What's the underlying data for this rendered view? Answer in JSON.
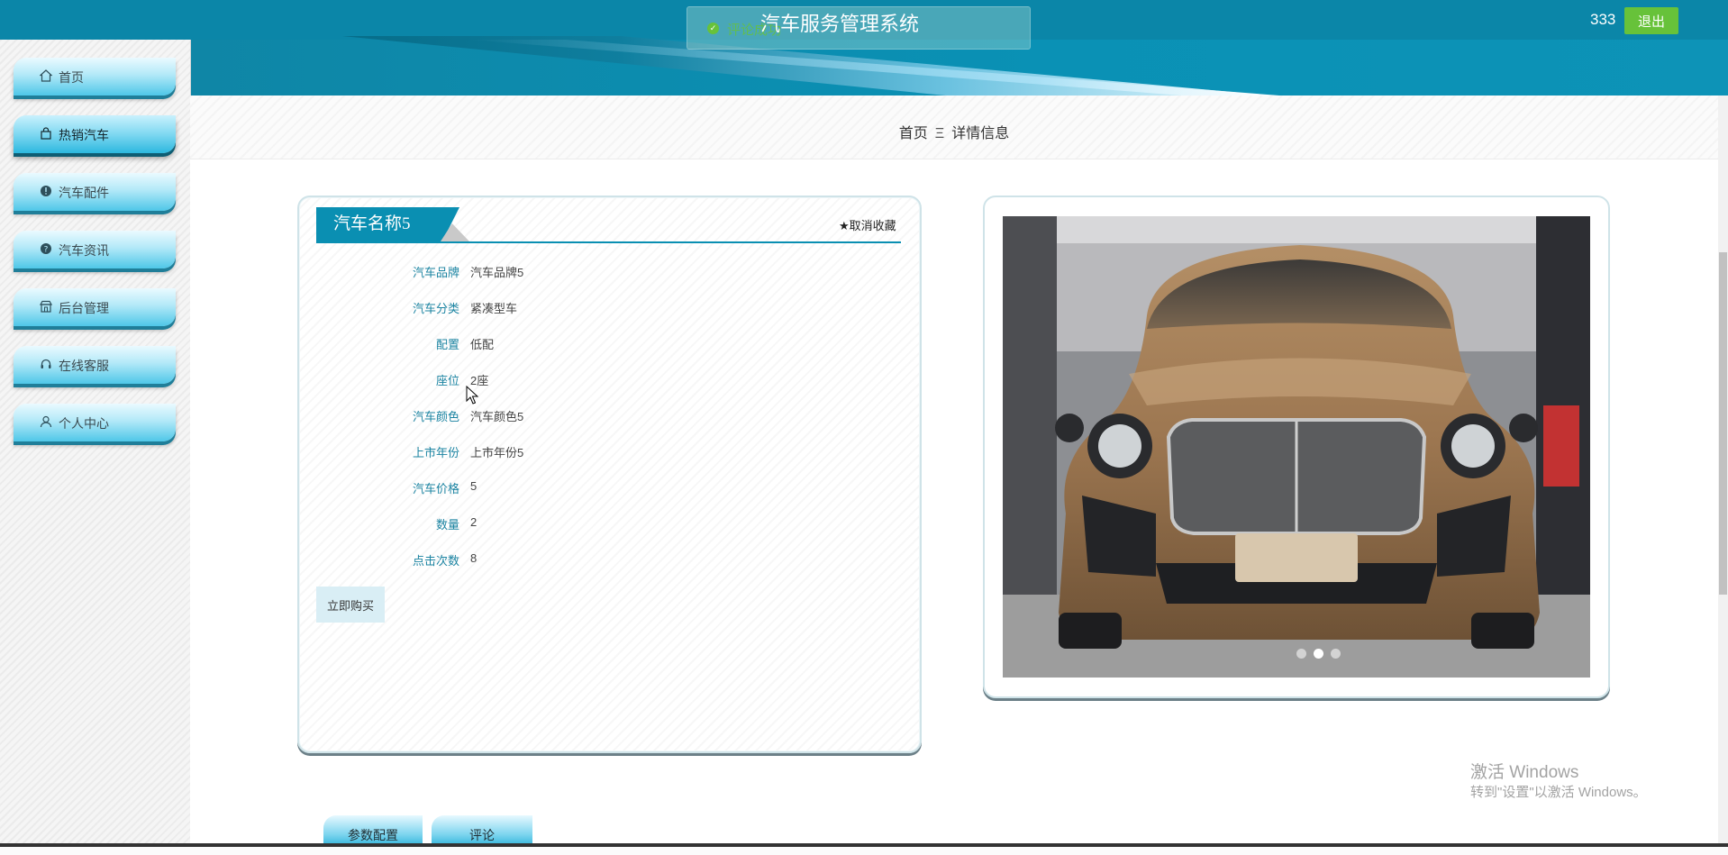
{
  "header": {
    "site_title": "汽车服务管理系统",
    "username": "333",
    "logout_label": "退出",
    "toast_text": "评论成功"
  },
  "sidebar": {
    "items": [
      {
        "label": "首页",
        "icon": "home-icon"
      },
      {
        "label": "热销汽车",
        "icon": "bag-icon"
      },
      {
        "label": "汽车配件",
        "icon": "info-circle-icon"
      },
      {
        "label": "汽车资讯",
        "icon": "question-circle-icon"
      },
      {
        "label": "后台管理",
        "icon": "store-icon"
      },
      {
        "label": "在线客服",
        "icon": "headset-icon"
      },
      {
        "label": "个人中心",
        "icon": "user-icon"
      }
    ],
    "active_index": 1
  },
  "breadcrumb": {
    "home": "首页",
    "separator": "Ξ",
    "current": "详情信息"
  },
  "detail": {
    "title": "汽车名称5",
    "unfavorite_label": "★取消收藏",
    "fields": [
      {
        "label": "汽车品牌",
        "value": "汽车品牌5"
      },
      {
        "label": "汽车分类",
        "value": "紧凑型车"
      },
      {
        "label": "配置",
        "value": "低配"
      },
      {
        "label": "座位",
        "value": "2座"
      },
      {
        "label": "汽车颜色",
        "value": "汽车颜色5"
      },
      {
        "label": "上市年份",
        "value": "上市年份5"
      },
      {
        "label": "汽车价格",
        "value": "5"
      },
      {
        "label": "数量",
        "value": "2"
      },
      {
        "label": "点击次数",
        "value": "8"
      }
    ],
    "buy_label": "立即购买"
  },
  "carousel": {
    "slide_count": 3,
    "active_slide": 2
  },
  "tabs": [
    {
      "label": "参数配置"
    },
    {
      "label": "评论"
    }
  ],
  "watermark": {
    "line1": "激活 Windows",
    "line2": "转到\"设置\"以激活 Windows。"
  },
  "colors": {
    "header": "#0b86a8",
    "accent": "#0a8fb2",
    "logout": "#67c23a",
    "label": "#1c84a2"
  }
}
